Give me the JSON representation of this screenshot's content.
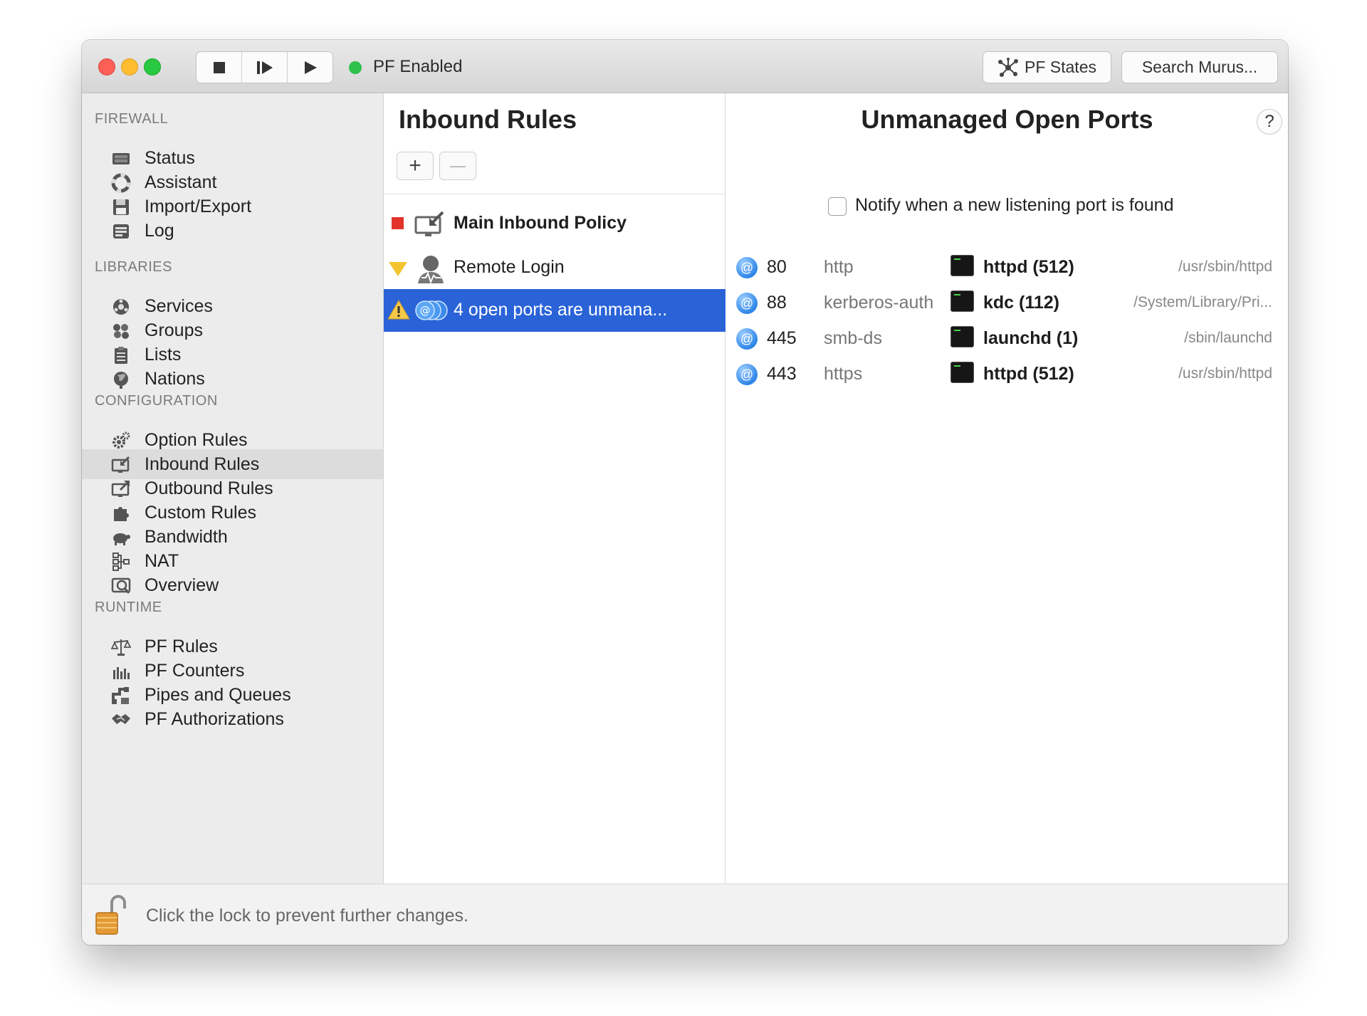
{
  "titlebar": {
    "pf_status": "PF Enabled",
    "pf_states_label": "PF States",
    "search_label": "Search Murus..."
  },
  "sidebar": {
    "sections": [
      {
        "title": "FIREWALL",
        "items": [
          {
            "label": "Status",
            "icon": "status-icon"
          },
          {
            "label": "Assistant",
            "icon": "lifebuoy-icon"
          },
          {
            "label": "Import/Export",
            "icon": "floppy-icon"
          },
          {
            "label": "Log",
            "icon": "log-icon"
          }
        ]
      },
      {
        "title": "LIBRARIES",
        "items": [
          {
            "label": "Services",
            "icon": "services-icon"
          },
          {
            "label": "Groups",
            "icon": "groups-icon"
          },
          {
            "label": "Lists",
            "icon": "clipboard-icon"
          },
          {
            "label": "Nations",
            "icon": "globe-icon"
          }
        ]
      },
      {
        "title": "CONFIGURATION",
        "items": [
          {
            "label": "Option Rules",
            "icon": "gears-icon"
          },
          {
            "label": "Inbound Rules",
            "icon": "inbound-icon",
            "selected": true
          },
          {
            "label": "Outbound Rules",
            "icon": "outbound-icon"
          },
          {
            "label": "Custom Rules",
            "icon": "puzzle-icon"
          },
          {
            "label": "Bandwidth",
            "icon": "turtle-icon"
          },
          {
            "label": "NAT",
            "icon": "nat-icon"
          },
          {
            "label": "Overview",
            "icon": "overview-icon"
          }
        ]
      },
      {
        "title": "RUNTIME",
        "items": [
          {
            "label": "PF Rules",
            "icon": "scales-icon"
          },
          {
            "label": "PF Counters",
            "icon": "counters-icon"
          },
          {
            "label": "Pipes and Queues",
            "icon": "pipes-icon"
          },
          {
            "label": "PF Authorizations",
            "icon": "handshake-icon"
          }
        ]
      }
    ]
  },
  "middle": {
    "title": "Inbound Rules",
    "add_symbol": "+",
    "remove_symbol": "—",
    "rules": [
      {
        "label": "Main Inbound Policy",
        "bold": true,
        "marker": "red-square",
        "icon": "inbound-monitor-icon"
      },
      {
        "label": "Remote Login",
        "bold": false,
        "marker": "yellow-triangle",
        "icon": "remote-login-icon"
      },
      {
        "label": "4 open ports are unmana...",
        "bold": false,
        "marker": "warning",
        "icon": "at-ports-icon",
        "selected": true
      }
    ]
  },
  "right": {
    "title": "Unmanaged Open Ports",
    "help": "?",
    "notify_label": "Notify when a new listening port is found",
    "notify_checked": false,
    "ports": [
      {
        "port": "80",
        "service": "http",
        "process": "httpd (512)",
        "path": "/usr/sbin/httpd"
      },
      {
        "port": "88",
        "service": "kerberos-auth",
        "process": "kdc (112)",
        "path": "/System/Library/Pri..."
      },
      {
        "port": "445",
        "service": "smb-ds",
        "process": "launchd (1)",
        "path": "/sbin/launchd"
      },
      {
        "port": "443",
        "service": "https",
        "process": "httpd (512)",
        "path": "/usr/sbin/httpd"
      }
    ]
  },
  "footer": {
    "lock_text": "Click the lock to prevent further changes."
  },
  "colors": {
    "selection": "#2a63d8",
    "pf_dot": "#2fc14b",
    "close": "#fe5f57",
    "minimize": "#febc2e",
    "zoom": "#28c840"
  }
}
